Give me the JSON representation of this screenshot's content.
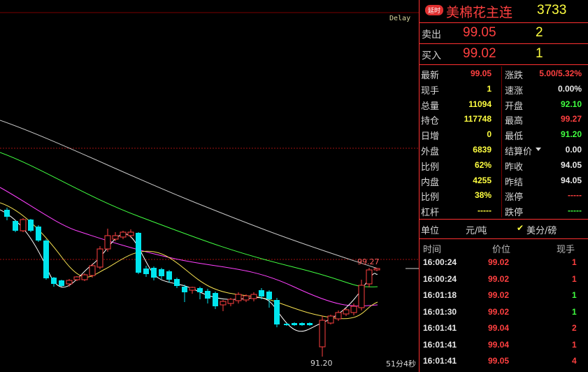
{
  "chart": {
    "delay_label": "Delay",
    "timer_label": "51分4秒",
    "high_label": "99.27",
    "low_label": "91.20",
    "colors": {
      "up": "#ff4040",
      "down": "#00e5ee",
      "ma5": "#ffffff",
      "ma10": "#f5e050",
      "ma20": "#ff40ff",
      "ma40": "#40ff40",
      "ma60": "#c8c8c8"
    }
  },
  "header": {
    "badge": "延时",
    "title": "美棉花主连",
    "code": "3733"
  },
  "quotes": [
    {
      "label": "卖出",
      "price": "99.05",
      "volume": "2"
    },
    {
      "label": "买入",
      "price": "99.02",
      "volume": "1"
    }
  ],
  "stats": {
    "left": [
      {
        "label": "最新",
        "value": "99.05",
        "color": "red"
      },
      {
        "label": "现手",
        "value": "1",
        "color": "yellow"
      },
      {
        "label": "总量",
        "value": "11094",
        "color": "yellow"
      },
      {
        "label": "持仓",
        "value": "117748",
        "color": "yellow"
      },
      {
        "label": "日增",
        "value": "0",
        "color": "yellow"
      },
      {
        "label": "外盘",
        "value": "6839",
        "color": "yellow"
      },
      {
        "label": "比例",
        "value": "62%",
        "color": "yellow"
      },
      {
        "label": "内盘",
        "value": "4255",
        "color": "yellow"
      },
      {
        "label": "比例",
        "value": "38%",
        "color": "yellow"
      },
      {
        "label": "杠杆",
        "value": "-----",
        "color": "yellow"
      }
    ],
    "right": [
      {
        "label": "涨跌",
        "value": "5.00/5.32%",
        "color": "red"
      },
      {
        "label": "速涨",
        "value": "0.00%",
        "color": "white"
      },
      {
        "label": "开盘",
        "value": "92.10",
        "color": "green"
      },
      {
        "label": "最高",
        "value": "99.27",
        "color": "red"
      },
      {
        "label": "最低",
        "value": "91.20",
        "color": "green"
      },
      {
        "label": "结算价",
        "value": "0.00",
        "color": "white"
      },
      {
        "label": "昨收",
        "value": "94.05",
        "color": "white"
      },
      {
        "label": "昨结",
        "value": "94.05",
        "color": "white"
      },
      {
        "label": "涨停",
        "value": "-----",
        "color": "red"
      },
      {
        "label": "跌停",
        "value": "-----",
        "color": "green"
      }
    ]
  },
  "unit": {
    "label": "单位",
    "value": "元/吨",
    "checkbox": "✔",
    "currency": "美分/磅"
  },
  "ticks": {
    "headers": [
      "时间",
      "价位",
      "现手"
    ],
    "rows": [
      {
        "time": "16:00:24",
        "price": "99.02",
        "volume": "1",
        "vcolor": "red"
      },
      {
        "time": "16:00:24",
        "price": "99.02",
        "volume": "1",
        "vcolor": "red"
      },
      {
        "time": "16:01:18",
        "price": "99.02",
        "volume": "1",
        "vcolor": "green"
      },
      {
        "time": "16:01:30",
        "price": "99.02",
        "volume": "1",
        "vcolor": "green"
      },
      {
        "time": "16:01:41",
        "price": "99.04",
        "volume": "2",
        "vcolor": "red"
      },
      {
        "time": "16:01:41",
        "price": "99.04",
        "volume": "1",
        "vcolor": "red"
      },
      {
        "time": "16:01:41",
        "price": "99.05",
        "volume": "4",
        "vcolor": "red"
      }
    ]
  }
}
